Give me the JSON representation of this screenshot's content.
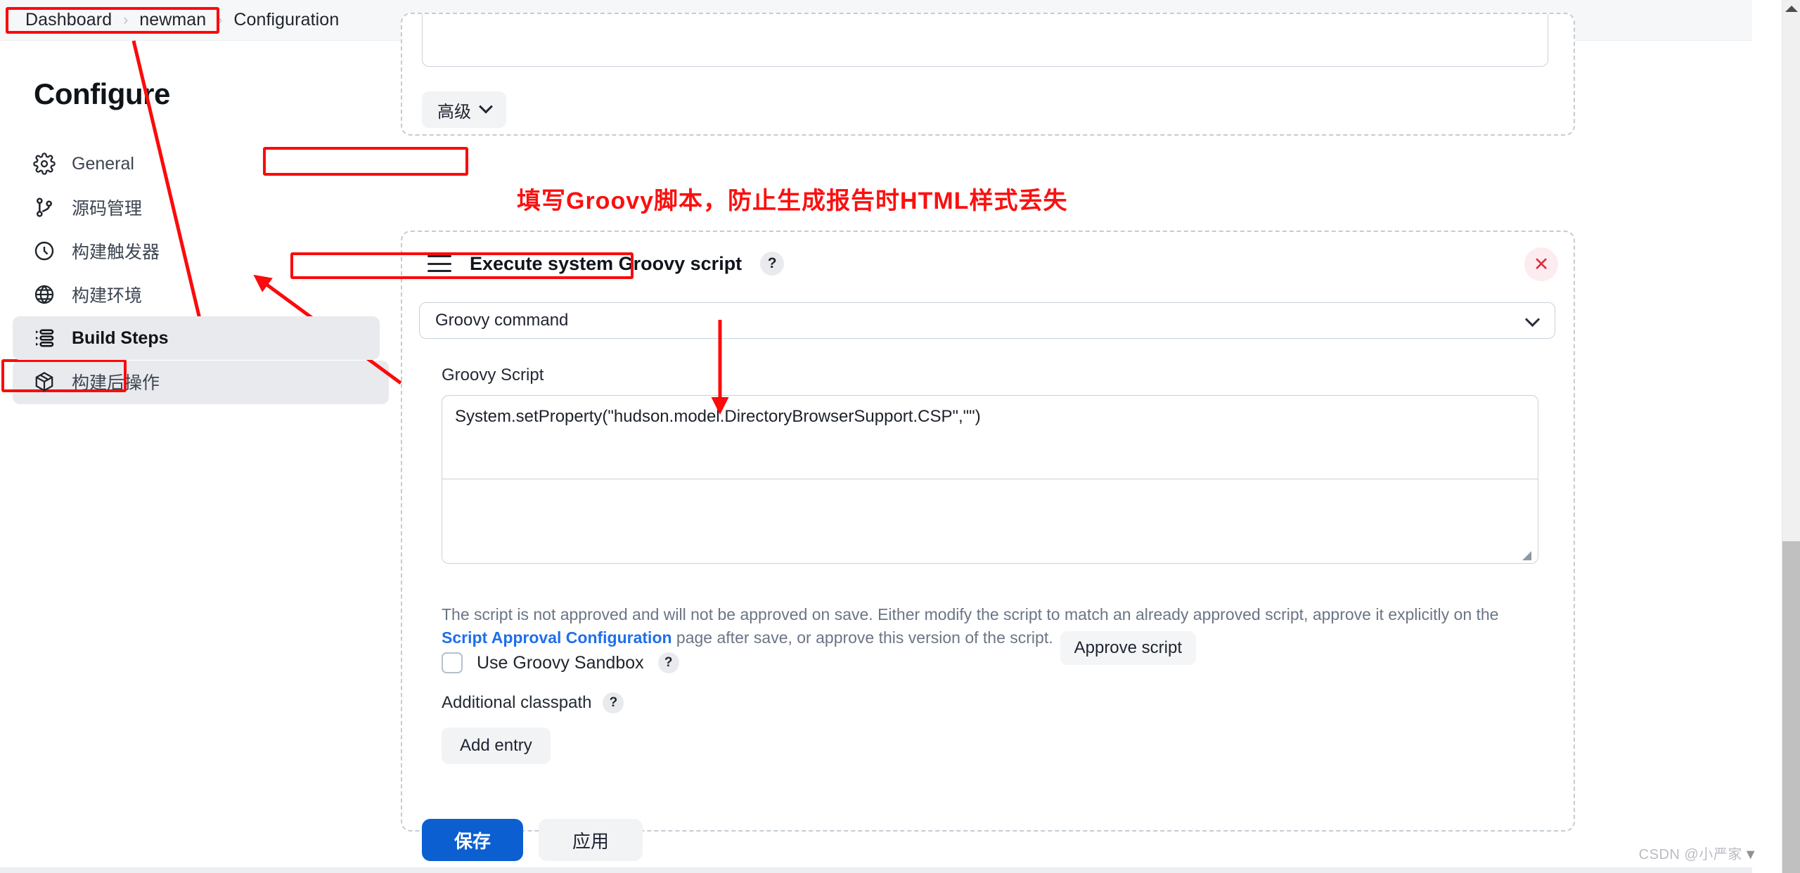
{
  "breadcrumb": {
    "items": [
      "Dashboard",
      "newman",
      "Configuration"
    ],
    "separator": "›"
  },
  "sidebar": {
    "title": "Configure",
    "items": [
      {
        "label": "General",
        "icon": "gear-icon",
        "active": false
      },
      {
        "label": "源码管理",
        "icon": "source-branch-icon",
        "active": false
      },
      {
        "label": "构建触发器",
        "icon": "clock-icon",
        "active": false
      },
      {
        "label": "构建环境",
        "icon": "globe-icon",
        "active": false
      },
      {
        "label": "Build Steps",
        "icon": "list-steps-icon",
        "active": true
      },
      {
        "label": "构建后操作",
        "icon": "package-icon",
        "active": false
      }
    ]
  },
  "top_block": {
    "textarea_value": "",
    "advanced_button": "高级",
    "chevron_icon": "chevron-down-icon"
  },
  "groovy_step": {
    "drag_handle_icon": "drag-handle-icon",
    "title": "Execute system Groovy script",
    "help_icon": "help-question-icon",
    "close_icon": "close-x-icon",
    "command_select": {
      "value": "Groovy command",
      "chevron_icon": "chevron-down-icon"
    },
    "script_label": "Groovy Script",
    "script_value": "System.setProperty(\"hudson.model.DirectoryBrowserSupport.CSP\",\"\")",
    "warning": {
      "part1": "The script is not approved and will not be approved on save. Either modify the script to match an already approved script, approve it explicitly on the ",
      "link": "Script Approval Configuration",
      "part2": " page after save, or approve this version of the script.",
      "approve_button": "Approve script"
    },
    "sandbox": {
      "label": "Use Groovy Sandbox",
      "checked": false,
      "help_icon": "help-question-icon"
    },
    "classpath": {
      "label": "Additional classpath",
      "help_icon": "help-question-icon",
      "add_entry_button": "Add entry"
    }
  },
  "footer": {
    "save_label": "保存",
    "apply_label": "应用"
  },
  "annotations": {
    "note_text": "填写Groovy脚本，防止生成报告时HTML样式丢失",
    "accent_color": "#fb0b0b"
  },
  "scrollbar": {
    "up_arrow_icon": "scroll-up-arrow-icon"
  },
  "watermark": {
    "text": "CSDN @小严家"
  }
}
